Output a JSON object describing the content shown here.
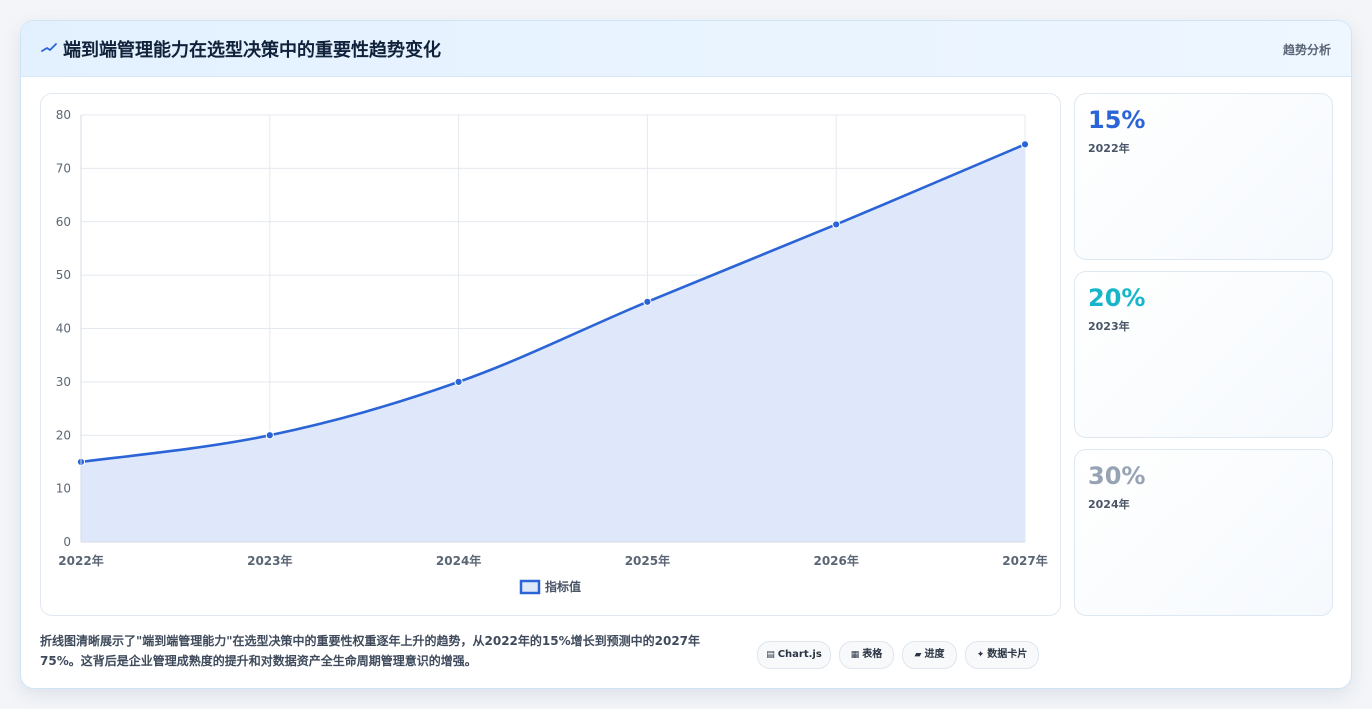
{
  "header": {
    "title": "端到端管理能力在选型决策中的重要性趋势变化",
    "tag": "趋势分析",
    "icon": "trend-icon",
    "accent": "#2b64d6"
  },
  "chart_data": {
    "type": "area",
    "categories": [
      "2022年",
      "2023年",
      "2024年",
      "2025年",
      "2026年",
      "2027年"
    ],
    "series": [
      {
        "name": "指标值",
        "values": [
          15,
          20,
          30,
          45,
          59.5,
          74.5
        ],
        "color": "#2b64d6",
        "fill": "#dfe8fa"
      }
    ],
    "yticks": [
      0,
      10,
      20,
      30,
      40,
      50,
      60,
      70,
      80
    ],
    "ylim": [
      0,
      80
    ],
    "grid": true,
    "legend": "bottom-center",
    "title": "",
    "xlabel": "",
    "ylabel": ""
  },
  "stats": [
    {
      "value": "15%",
      "label": "2022年",
      "color": "#2b64d6"
    },
    {
      "value": "20%",
      "label": "2023年",
      "color": "#16b5c9"
    },
    {
      "value": "30%",
      "label": "2024年",
      "color": "#97a3b4"
    }
  ],
  "footer": {
    "text": "折线图清晰展示了\"端到端管理能力\"在选型决策中的重要性权重逐年上升的趋势，从2022年的15%增长到预测中的2027年75%。这背后是企业管理成熟度的提升和对数据资产全生命周期管理意识的增强。"
  },
  "chips": [
    {
      "glyph": "▤",
      "label": "Chart.js",
      "icon": "chart-icon"
    },
    {
      "glyph": "▦",
      "label": "表格",
      "icon": "table-icon"
    },
    {
      "glyph": "▰",
      "label": "进度",
      "icon": "progress-icon"
    },
    {
      "glyph": "✦",
      "label": "数据卡片",
      "icon": "sparkle-icon"
    }
  ]
}
